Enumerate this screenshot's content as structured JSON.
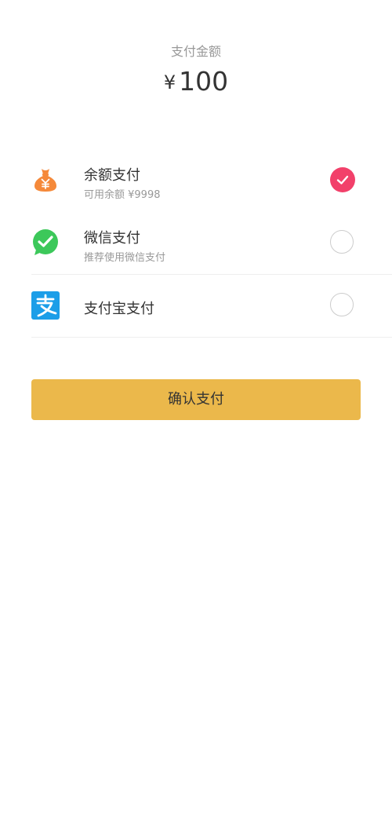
{
  "payment": {
    "amount_label": "支付金额",
    "currency_symbol": "¥",
    "amount_value": "100"
  },
  "methods": [
    {
      "name": "余额支付",
      "subtitle": "可用余额 ¥9998",
      "icon": "money-bag-icon",
      "selected": true
    },
    {
      "name": "微信支付",
      "subtitle": "推荐使用微信支付",
      "icon": "wechat-icon",
      "selected": false
    },
    {
      "name": "支付宝支付",
      "icon": "alipay-icon",
      "selected": false
    }
  ],
  "confirm_label": "确认支付",
  "colors": {
    "selected_radio": "#f2406a",
    "confirm_button": "#ebb84b",
    "wechat_green": "#3cc85a",
    "alipay_blue": "#1c9ee8",
    "balance_orange": "#f5893a"
  }
}
